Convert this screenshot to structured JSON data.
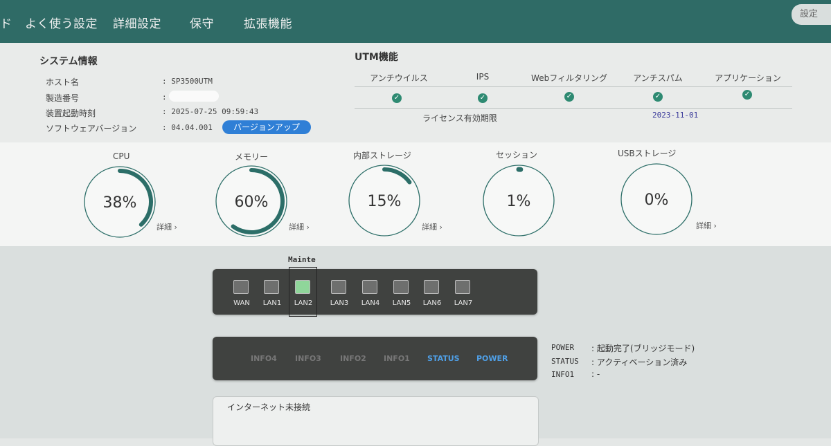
{
  "nav": {
    "items": [
      "ド",
      "よく使う設定",
      "詳細設定",
      "保守",
      "拡張機能"
    ],
    "settings_label": "設定"
  },
  "system_info": {
    "title": "システム情報",
    "rows": [
      {
        "label": "ホスト名",
        "value": ": SP3500UTM"
      },
      {
        "label": "製造番号",
        "value": ":"
      },
      {
        "label": "装置起動時刻",
        "value": ": 2025-07-25 09:59:43"
      },
      {
        "label": "ソフトウェアバージョン",
        "value": ": 04.04.001"
      }
    ],
    "version_up_label": "バージョンアップ"
  },
  "utm": {
    "title": "UTM機能",
    "features": [
      "アンチウイルス",
      "IPS",
      "Webフィルタリング",
      "アンチスパム",
      "アプリケーション"
    ],
    "license_label": "ライセンス有効期限",
    "license_date": "2023-11-01"
  },
  "gauges": [
    {
      "label": "CPU",
      "value": "38%",
      "percent": 38,
      "detail": "詳細"
    },
    {
      "label": "メモリー",
      "value": "60%",
      "percent": 60,
      "detail": "詳細"
    },
    {
      "label": "内部ストレージ",
      "value": "15%",
      "percent": 15,
      "detail": "詳細"
    },
    {
      "label": "セッション",
      "value": "1%",
      "percent": 1,
      "detail": ""
    },
    {
      "label": "USBストレージ",
      "value": "0%",
      "percent": 0,
      "detail": "詳細"
    }
  ],
  "ports": {
    "mainte_label": "Mainte",
    "list": [
      "WAN",
      "LAN1",
      "LAN2",
      "LAN3",
      "LAN4",
      "LAN5",
      "LAN6",
      "LAN7"
    ],
    "active_port": "LAN2",
    "active_color": "#8fd69a"
  },
  "leds": {
    "list": [
      "INFO4",
      "INFO3",
      "INFO2",
      "INFO1",
      "STATUS",
      "POWER"
    ],
    "lit": [
      "STATUS",
      "POWER"
    ],
    "lit_color": "#4f9fe6"
  },
  "status": [
    {
      "key": "POWER",
      "value": ": 起動完了(ブリッジモード)"
    },
    {
      "key": "STATUS",
      "value": ": アクティベーション済み"
    },
    {
      "key": "INFO1",
      "value": ": -"
    }
  ],
  "message": "インターネット未接続"
}
